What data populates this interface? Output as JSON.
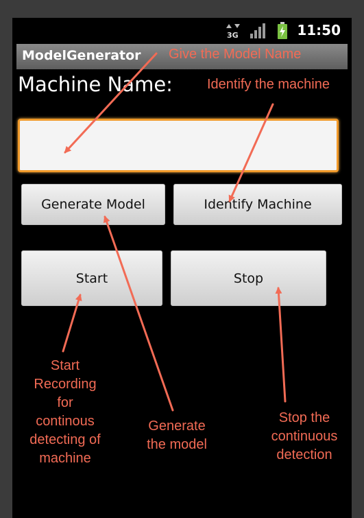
{
  "status_bar": {
    "network": "3G",
    "time": "11:50",
    "icons": [
      "data-transfer-3g-icon",
      "signal-bars-icon",
      "battery-charging-icon"
    ]
  },
  "app": {
    "title": "ModelGenerator"
  },
  "form": {
    "machine_label": "Machine Name:",
    "machine_name_value": ""
  },
  "buttons": {
    "generate_model": "Generate Model",
    "identify_machine": "Identify Machine",
    "start": "Start",
    "stop": "Stop"
  },
  "annotations": {
    "give_name": "Give the Model Name",
    "identify": "Identify the machine",
    "start_line1": "Start",
    "start_line2": "Recording",
    "start_line3": "for",
    "start_line4": "continous",
    "start_line5": "detecting of",
    "start_line6": "machine",
    "generate_line1": "Generate",
    "generate_line2": "the model",
    "stop_line1": "Stop the",
    "stop_line2": "continuous",
    "stop_line3": "detection"
  },
  "colors": {
    "annotation": "#f26b55",
    "input_focus_border": "#f19a2a",
    "battery": "#7ac142"
  }
}
